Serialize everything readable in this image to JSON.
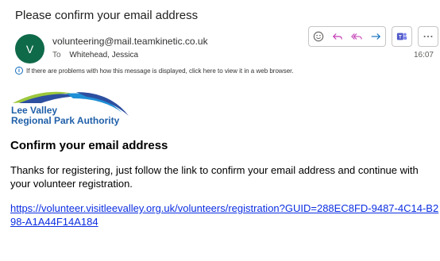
{
  "email": {
    "subject": "Please confirm your email address",
    "avatar_initial": "V",
    "sender": "volunteering@mail.teamkinetic.co.uk",
    "to_label": "To",
    "to_name": "Whitehead, Jessica",
    "time": "16:07",
    "info_message": "If there are problems with how this message is displayed, click here to view it in a web browser."
  },
  "toolbar": {
    "icons": [
      "emoji-icon",
      "reply-icon",
      "reply-all-icon",
      "forward-icon",
      "teams-icon",
      "more-icon"
    ]
  },
  "logo": {
    "line1": "Lee Valley",
    "line2": "Regional Park Authority"
  },
  "body": {
    "heading": "Confirm your email address",
    "paragraph": "Thanks for registering, just follow the link to confirm your email address and continue with your volunteer registration.",
    "link": "https://volunteer.visitleevalley.org.uk/volunteers/registration?GUID=288EC8FD-9487-4C14-B298-A1A44F14A184"
  },
  "colors": {
    "avatar": "#0f6a4a",
    "accent": "#0f6cbd",
    "link": "#0b2ee0",
    "logo_blue": "#1f5fa8",
    "logo_green": "#9cc83c"
  }
}
